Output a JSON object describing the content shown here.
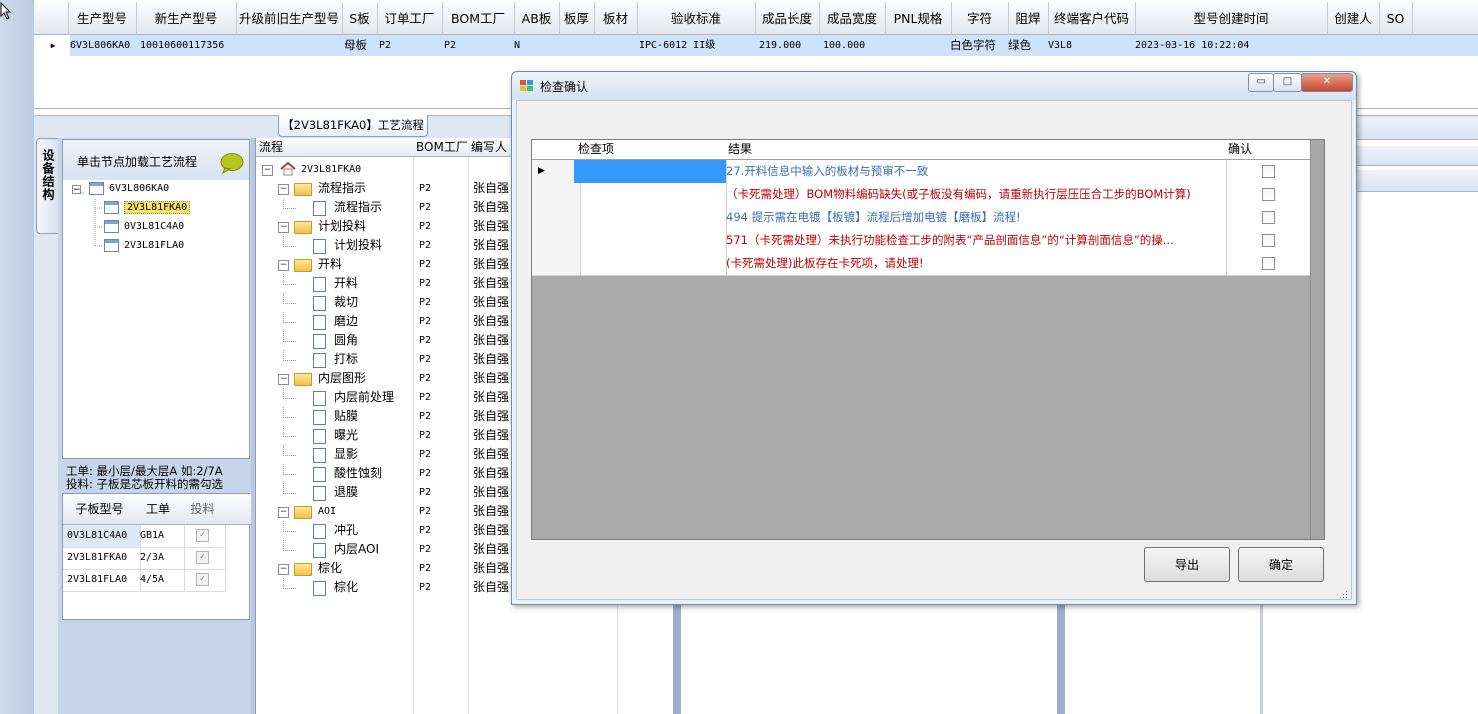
{
  "main_grid": {
    "columns": [
      "生产型号",
      "新生产型号",
      "升级前旧生产型号",
      "S板",
      "订单工厂",
      "BOM工厂",
      "AB板",
      "板厚",
      "板材",
      "验收标准",
      "成品长度",
      "成品宽度",
      "PNL规格",
      "字符",
      "阻焊",
      "终端客户代码",
      "型号创建时间",
      "创建人",
      "SO"
    ],
    "row": {
      "marker": "▶",
      "prod_no": "6V3L806KA0",
      "new_prod_no": "10010600117356",
      "old_prod_no": "",
      "s_board": "母板",
      "order_factory": "P2",
      "bom_factory": "P2",
      "ab_board": "N",
      "thickness": "",
      "material": "",
      "standard": "IPC-6012 II级",
      "length": "219.000",
      "width": "100.000",
      "pnl": "",
      "char": "白色字符",
      "mask": "绿色",
      "customer_code": "V3L8",
      "created_at": "2023-03-16 10:22:04",
      "creator": "",
      "so": ""
    }
  },
  "side_tab": {
    "label": "设备结构"
  },
  "process_title": "【2V3L81FKA0】工艺流程",
  "left_tree": {
    "hint": "单击节点加载工艺流程",
    "nodes": [
      "6V3L806KA0",
      "2V3L81FKA0",
      "0V3L81C4A0",
      "2V3L81FLA0"
    ],
    "note_line1": "工单: 最小层/最大层A 如:2/7A",
    "note_line2": "投料: 子板是芯板开料的需勾选"
  },
  "sub_table": {
    "headers": [
      "子板型号",
      "工单",
      "投料"
    ],
    "rows": [
      {
        "model": "0V3L81C4A0",
        "order": "GB1A",
        "feed": "✓"
      },
      {
        "model": "2V3L81FKA0",
        "order": "2/3A",
        "feed": "✓"
      },
      {
        "model": "2V3L81FLA0",
        "order": "4/5A",
        "feed": "✓"
      }
    ]
  },
  "process_tree": {
    "headers": [
      "流程",
      "BOM工厂",
      "编写人"
    ],
    "root": "2V3L81FKA0",
    "rows": [
      {
        "label": "流程指示",
        "type": "folder",
        "factory": "P2",
        "writer": "张自强"
      },
      {
        "label": "流程指示",
        "type": "doc",
        "factory": "P2",
        "writer": "张自强"
      },
      {
        "label": "计划投料",
        "type": "folder",
        "factory": "P2",
        "writer": "张自强"
      },
      {
        "label": "计划投料",
        "type": "doc",
        "factory": "P2",
        "writer": "张自强"
      },
      {
        "label": "开料",
        "type": "folder",
        "factory": "P2",
        "writer": "张自强"
      },
      {
        "label": "开料",
        "type": "doc",
        "factory": "P2",
        "writer": "张自强"
      },
      {
        "label": "裁切",
        "type": "doc",
        "factory": "P2",
        "writer": "张自强"
      },
      {
        "label": "磨边",
        "type": "doc",
        "factory": "P2",
        "writer": "张自强"
      },
      {
        "label": "圆角",
        "type": "doc",
        "factory": "P2",
        "writer": "张自强"
      },
      {
        "label": "打标",
        "type": "doc",
        "factory": "P2",
        "writer": "张自强"
      },
      {
        "label": "内层图形",
        "type": "folder",
        "factory": "P2",
        "writer": "张自强"
      },
      {
        "label": "内层前处理",
        "type": "doc",
        "factory": "P2",
        "writer": "张自强"
      },
      {
        "label": "贴膜",
        "type": "doc",
        "factory": "P2",
        "writer": "张自强"
      },
      {
        "label": "曝光",
        "type": "doc",
        "factory": "P2",
        "writer": "张自强"
      },
      {
        "label": "显影",
        "type": "doc",
        "factory": "P2",
        "writer": "张自强"
      },
      {
        "label": "酸性蚀刻",
        "type": "doc",
        "factory": "P2",
        "writer": "张自强"
      },
      {
        "label": "退膜",
        "type": "doc",
        "factory": "P2",
        "writer": "张自强"
      },
      {
        "label": "AOI",
        "type": "folder",
        "factory": "P2",
        "writer": "张自强"
      },
      {
        "label": "冲孔",
        "type": "doc",
        "factory": "P2",
        "writer": "张自强"
      },
      {
        "label": "内层AOI",
        "type": "doc",
        "factory": "P2",
        "writer": "张自强"
      },
      {
        "label": "棕化",
        "type": "folder",
        "factory": "P2",
        "writer": "张自强"
      },
      {
        "label": "棕化",
        "type": "doc",
        "factory": "P2",
        "writer": "张自强"
      }
    ]
  },
  "dialog": {
    "title": "检查确认",
    "headers": [
      "检查项",
      "结果",
      "确认"
    ],
    "rows": [
      {
        "item": "",
        "result": "27.开料信息中输入的板材与预审不一致",
        "color": "#3b6fb0"
      },
      {
        "item": "",
        "result": "（卡死需处理）BOM物料编码缺失(或子板没有编码，请重新执行层压压合工步的BOM计算)",
        "color": "#c00000"
      },
      {
        "item": "",
        "result": "494 提示需在电镀【板镀】流程后增加电镀【磨板】流程!",
        "color": "#3b6fb0"
      },
      {
        "item": "",
        "result": "571（卡死需处理）未执行功能检查工步的附表“产品剖面信息”的“计算剖面信息”的操...",
        "color": "#c00000"
      },
      {
        "item": "",
        "result": "(卡死需处理)此板存在卡死项，请处理!",
        "color": "#c00000"
      }
    ],
    "export_label": "导出",
    "ok_label": "确定",
    "min_glyph": "▭",
    "max_glyph": "□",
    "close_glyph": "✕"
  }
}
